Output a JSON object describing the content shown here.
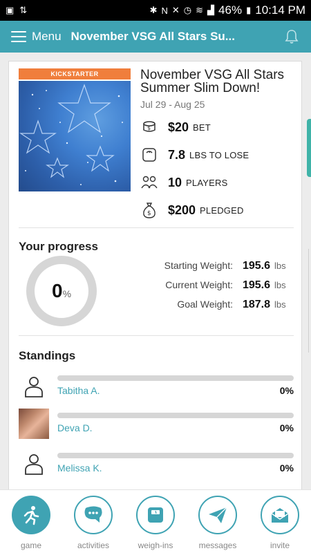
{
  "status_bar": {
    "battery": "46%",
    "time": "10:14 PM"
  },
  "app_bar": {
    "menu_label": "Menu",
    "title": "November VSG All Stars Su..."
  },
  "game": {
    "badge": "KICKSTARTER",
    "title_line1": "November VSG All Stars",
    "title_line2": "Summer Slim Down!",
    "dates": "Jul 29 - Aug 25",
    "stats": [
      {
        "value": "$20",
        "unit": "BET",
        "icon": "coins-icon"
      },
      {
        "value": "7.8",
        "unit": "LBS TO LOSE",
        "icon": "scale-icon"
      },
      {
        "value": "10",
        "unit": "PLAYERS",
        "icon": "players-icon"
      },
      {
        "value": "$200",
        "unit": "PLEDGED",
        "icon": "money-bag-icon"
      }
    ]
  },
  "progress": {
    "title": "Your progress",
    "percent_value": "0",
    "percent_sign": "%",
    "starting_label": "Starting Weight:",
    "starting_value": "195.6",
    "current_label": "Current Weight:",
    "current_value": "195.6",
    "goal_label": "Goal Weight:",
    "goal_value": "187.8",
    "unit": "lbs"
  },
  "standings": {
    "title": "Standings",
    "rows": [
      {
        "name": "Tabitha A.",
        "percent": "0%"
      },
      {
        "name": "Deva D.",
        "percent": "0%"
      },
      {
        "name": "Melissa K.",
        "percent": "0%"
      }
    ]
  },
  "bottom_nav": [
    {
      "label": "game",
      "icon": "runner-icon",
      "active": true
    },
    {
      "label": "activities",
      "icon": "chat-icon",
      "active": false
    },
    {
      "label": "weigh-ins",
      "icon": "scale-icon",
      "active": false
    },
    {
      "label": "messages",
      "icon": "paper-plane-icon",
      "active": false
    },
    {
      "label": "invite",
      "icon": "envelope-icon",
      "active": false
    }
  ],
  "colors": {
    "accent": "#3fa3b3",
    "badge": "#f07e3c"
  }
}
